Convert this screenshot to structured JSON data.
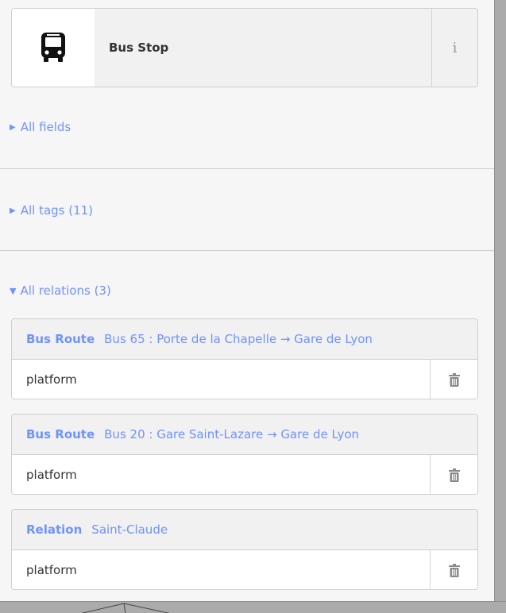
{
  "preset": {
    "icon": "bus-icon",
    "name": "Bus Stop",
    "info_label": "i"
  },
  "sections": {
    "all_fields": "All fields",
    "all_tags": "All tags (11)",
    "all_relations": "All relations (3)"
  },
  "relations": [
    {
      "type": "Bus Route",
      "name": "Bus 65 : Porte de la Chapelle → Gare de Lyon",
      "role": "platform"
    },
    {
      "type": "Bus Route",
      "name": "Bus 20 : Gare Saint-Lazare → Gare de Lyon",
      "role": "platform"
    },
    {
      "type": "Relation",
      "name": "Saint-Claude",
      "role": "platform"
    }
  ],
  "colors": {
    "link": "#7092ff",
    "panel_bg": "#f6f6f6",
    "border": "#cfcfcf"
  }
}
